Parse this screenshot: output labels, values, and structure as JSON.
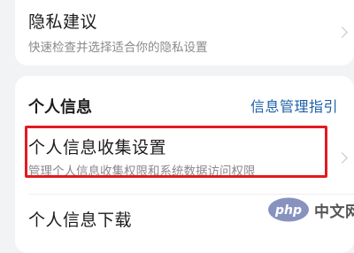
{
  "privacy_suggestion": {
    "title": "隐私建议",
    "subtitle": "快速检查并选择适合你的隐私设置"
  },
  "personal_info": {
    "section_title": "个人信息",
    "guide_link": "信息管理指引",
    "collection_settings": {
      "title": "个人信息收集设置",
      "subtitle": "管理个人信息收集权限和系统数据访问权限"
    },
    "download": {
      "title": "个人信息下载"
    }
  },
  "watermark": {
    "text": "中文网",
    "logo_text": "php"
  },
  "colors": {
    "background": "#f2f3f5",
    "card": "#ffffff",
    "link": "#1d5fa8",
    "highlight": "#e11b22"
  }
}
